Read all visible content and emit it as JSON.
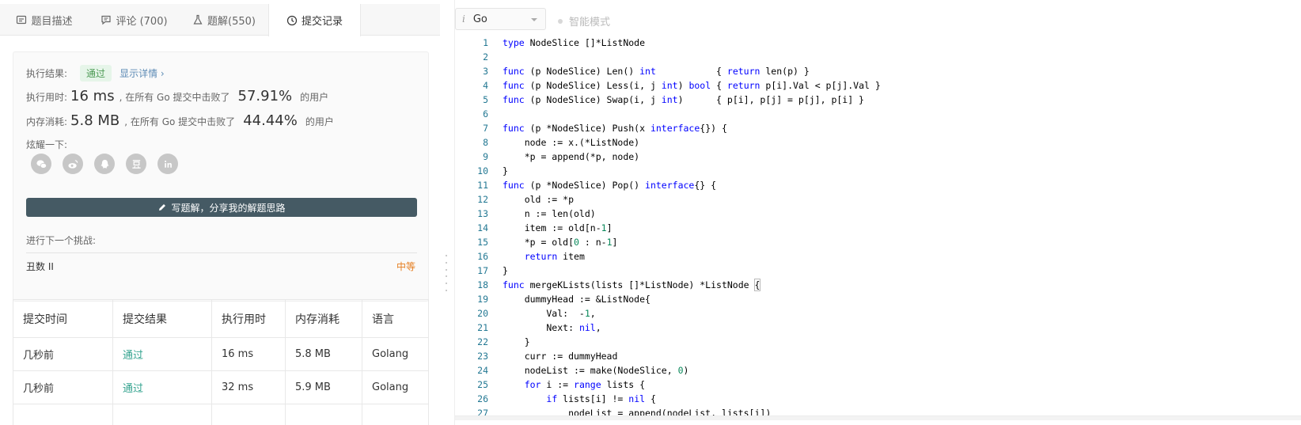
{
  "tabs": [
    {
      "label": "题目描述",
      "icon": "document-icon"
    },
    {
      "label": "评论 (700)",
      "icon": "comment-icon"
    },
    {
      "label": "题解(550)",
      "icon": "flask-icon"
    },
    {
      "label": "提交记录",
      "icon": "clock-icon"
    }
  ],
  "result": {
    "status_label": "执行结果:",
    "status_value": "通过",
    "detail_link": "显示详情 ›",
    "time_label": "执行用时:",
    "time_value": "16 ms",
    "time_desc": ", 在所有 Go 提交中击败了",
    "time_pct": "57.91%",
    "time_suffix": "的用户",
    "mem_label": "内存消耗:",
    "mem_value": "5.8 MB",
    "mem_desc": ", 在所有 Go 提交中击败了",
    "mem_pct": "44.44%",
    "mem_suffix": "的用户",
    "share_label": "炫耀一下:",
    "write_button": "写题解，分享我的解题思路",
    "next_label": "进行下一个挑战:",
    "next_problem": "丑数 II",
    "next_difficulty": "中等"
  },
  "submissions": {
    "headers": [
      "提交时间",
      "提交结果",
      "执行用时",
      "内存消耗",
      "语言"
    ],
    "rows": [
      [
        "几秒前",
        "通过",
        "16 ms",
        "5.8 MB",
        "Golang"
      ],
      [
        "几秒前",
        "通过",
        "32 ms",
        "5.9 MB",
        "Golang"
      ]
    ]
  },
  "editor": {
    "language": "Go",
    "smart_mode": "智能模式",
    "line_numbers": [
      "1",
      "2",
      "3",
      "4",
      "5",
      "6",
      "7",
      "8",
      "9",
      "10",
      "11",
      "12",
      "13",
      "14",
      "15",
      "16",
      "17",
      "18",
      "19",
      "20",
      "21",
      "22",
      "23",
      "24",
      "25",
      "26",
      "27"
    ]
  },
  "colors": {
    "keyword": "#0000ff",
    "number": "#09885a",
    "line_number": "#237893",
    "pass": "#34a38f",
    "difficulty_medium": "#e57d1f",
    "write_button_bg": "#455a64"
  }
}
